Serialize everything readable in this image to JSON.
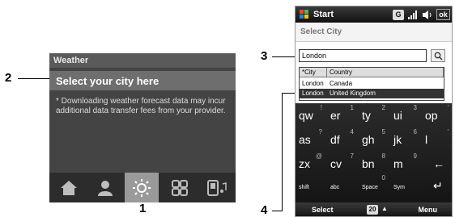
{
  "callouts": {
    "c1": "1",
    "c2": "2",
    "c3": "3",
    "c4": "4"
  },
  "weather": {
    "title": "Weather",
    "heading": "Select your city here",
    "note": "* Downloading weather forecast data may incur additional data transfer fees from your provider.",
    "tabs": [
      "home-icon",
      "contact-icon",
      "weather-sun-icon",
      "apps-grid-icon",
      "music-phone-icon"
    ]
  },
  "phone": {
    "status": {
      "start": "Start",
      "g_badge": "G",
      "ok": "ok"
    },
    "screen_title": "Select City",
    "search": {
      "value": "London"
    },
    "table": {
      "headers": [
        "*City",
        "Country"
      ],
      "rows": [
        {
          "city": "London",
          "country": "Canada"
        },
        {
          "city": "London",
          "country": "United Kingdom",
          "selected": true
        }
      ]
    },
    "keyboard": {
      "row1": [
        {
          "main": "qw",
          "alt": "!"
        },
        {
          "main": "er",
          "alt": "1"
        },
        {
          "main": "ty",
          "alt": "2"
        },
        {
          "main": "ui",
          "alt": "3"
        },
        {
          "main": "op",
          "alt": "'"
        }
      ],
      "row2": [
        {
          "main": "as",
          "alt": "?"
        },
        {
          "main": "df",
          "alt": "4"
        },
        {
          "main": "gh",
          "alt": "5"
        },
        {
          "main": "jk",
          "alt": "6"
        },
        {
          "main": "l",
          "alt": "'"
        }
      ],
      "row3": [
        {
          "main": "zx",
          "alt": "@"
        },
        {
          "main": "cv",
          "alt": "7"
        },
        {
          "main": "bn",
          "alt": "8"
        },
        {
          "main": "m",
          "alt": "9"
        },
        {
          "main": "←",
          "alt": ""
        }
      ],
      "row4": [
        {
          "main": "shift",
          "alt": ""
        },
        {
          "main": "abc",
          "alt": ""
        },
        {
          "main": "Space",
          "alt": "0"
        },
        {
          "main": "Sym",
          "alt": ""
        },
        {
          "main": "↵",
          "alt": ""
        }
      ]
    },
    "softkeys": {
      "left": "Select",
      "mid": "20",
      "right": "Menu"
    }
  }
}
